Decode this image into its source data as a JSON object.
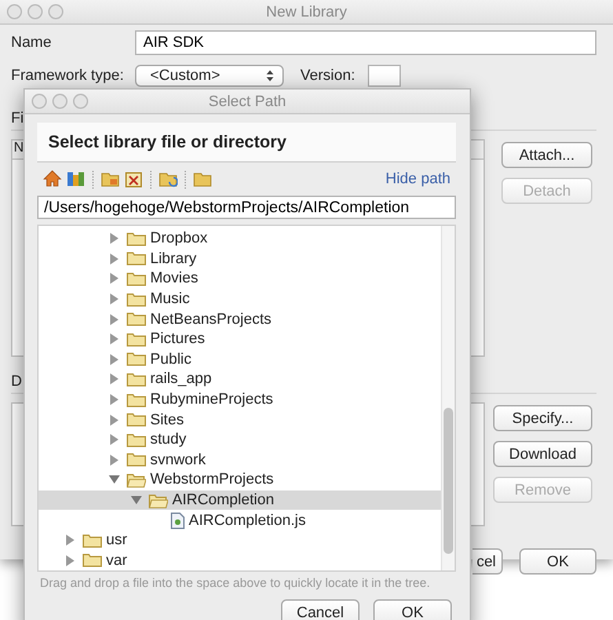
{
  "new_library": {
    "title": "New Library",
    "name": {
      "label": "Name",
      "value": "AIR SDK"
    },
    "framework_type": {
      "label": "Framework type:",
      "value": "<Custom>"
    },
    "version": {
      "label": "Version:"
    },
    "section_1": {
      "label": "Fi",
      "column_1": "N",
      "buttons": [
        {
          "label": "Attach...",
          "disabled": false
        },
        {
          "label": "Detach",
          "disabled": true
        }
      ]
    },
    "section_2": {
      "label": "D",
      "buttons": [
        {
          "label": "Specify...",
          "disabled": false
        },
        {
          "label": "Download",
          "disabled": false
        },
        {
          "label": "Remove",
          "disabled": true
        }
      ]
    },
    "footer_buttons": [
      {
        "label": "cel"
      },
      {
        "label": "OK"
      }
    ]
  },
  "select_path": {
    "title": "Select Path",
    "header": "Select library file or directory",
    "hide_path": "Hide path",
    "path": "/Users/hogehoge/WebstormProjects/AIRCompletion",
    "tree": {
      "partial_subtree": [
        {
          "name": "Dropbox",
          "kind": "folder",
          "expanded": false,
          "selected": false
        },
        {
          "name": "Library",
          "kind": "folder",
          "expanded": false,
          "selected": false
        },
        {
          "name": "Movies",
          "kind": "folder",
          "expanded": false,
          "selected": false
        },
        {
          "name": "Music",
          "kind": "folder",
          "expanded": false,
          "selected": false
        },
        {
          "name": "NetBeansProjects",
          "kind": "folder",
          "expanded": false,
          "selected": false
        },
        {
          "name": "Pictures",
          "kind": "folder",
          "expanded": false,
          "selected": false
        },
        {
          "name": "Public",
          "kind": "folder",
          "expanded": false,
          "selected": false
        },
        {
          "name": "rails_app",
          "kind": "folder",
          "expanded": false,
          "selected": false
        },
        {
          "name": "RubymineProjects",
          "kind": "folder",
          "expanded": false,
          "selected": false
        },
        {
          "name": "Sites",
          "kind": "folder",
          "expanded": false,
          "selected": false
        },
        {
          "name": "study",
          "kind": "folder",
          "expanded": false,
          "selected": false
        },
        {
          "name": "svnwork",
          "kind": "folder",
          "expanded": false,
          "selected": false
        },
        {
          "name": "WebstormProjects",
          "kind": "folder",
          "expanded": true,
          "selected": false,
          "children": [
            {
              "name": "AIRCompletion",
              "kind": "folder",
              "expanded": true,
              "selected": true,
              "children": [
                {
                  "name": "AIRCompletion.js",
                  "kind": "file",
                  "selected": false
                }
              ]
            }
          ]
        }
      ],
      "items": [
        {
          "name": "usr",
          "kind": "folder",
          "expanded": false,
          "selected": false
        },
        {
          "name": "var",
          "kind": "folder",
          "expanded": false,
          "selected": false
        }
      ]
    },
    "hint": "Drag and drop a file into the space above to quickly locate it in the tree.",
    "buttons": [
      {
        "label": "Cancel"
      },
      {
        "label": "OK"
      }
    ]
  }
}
